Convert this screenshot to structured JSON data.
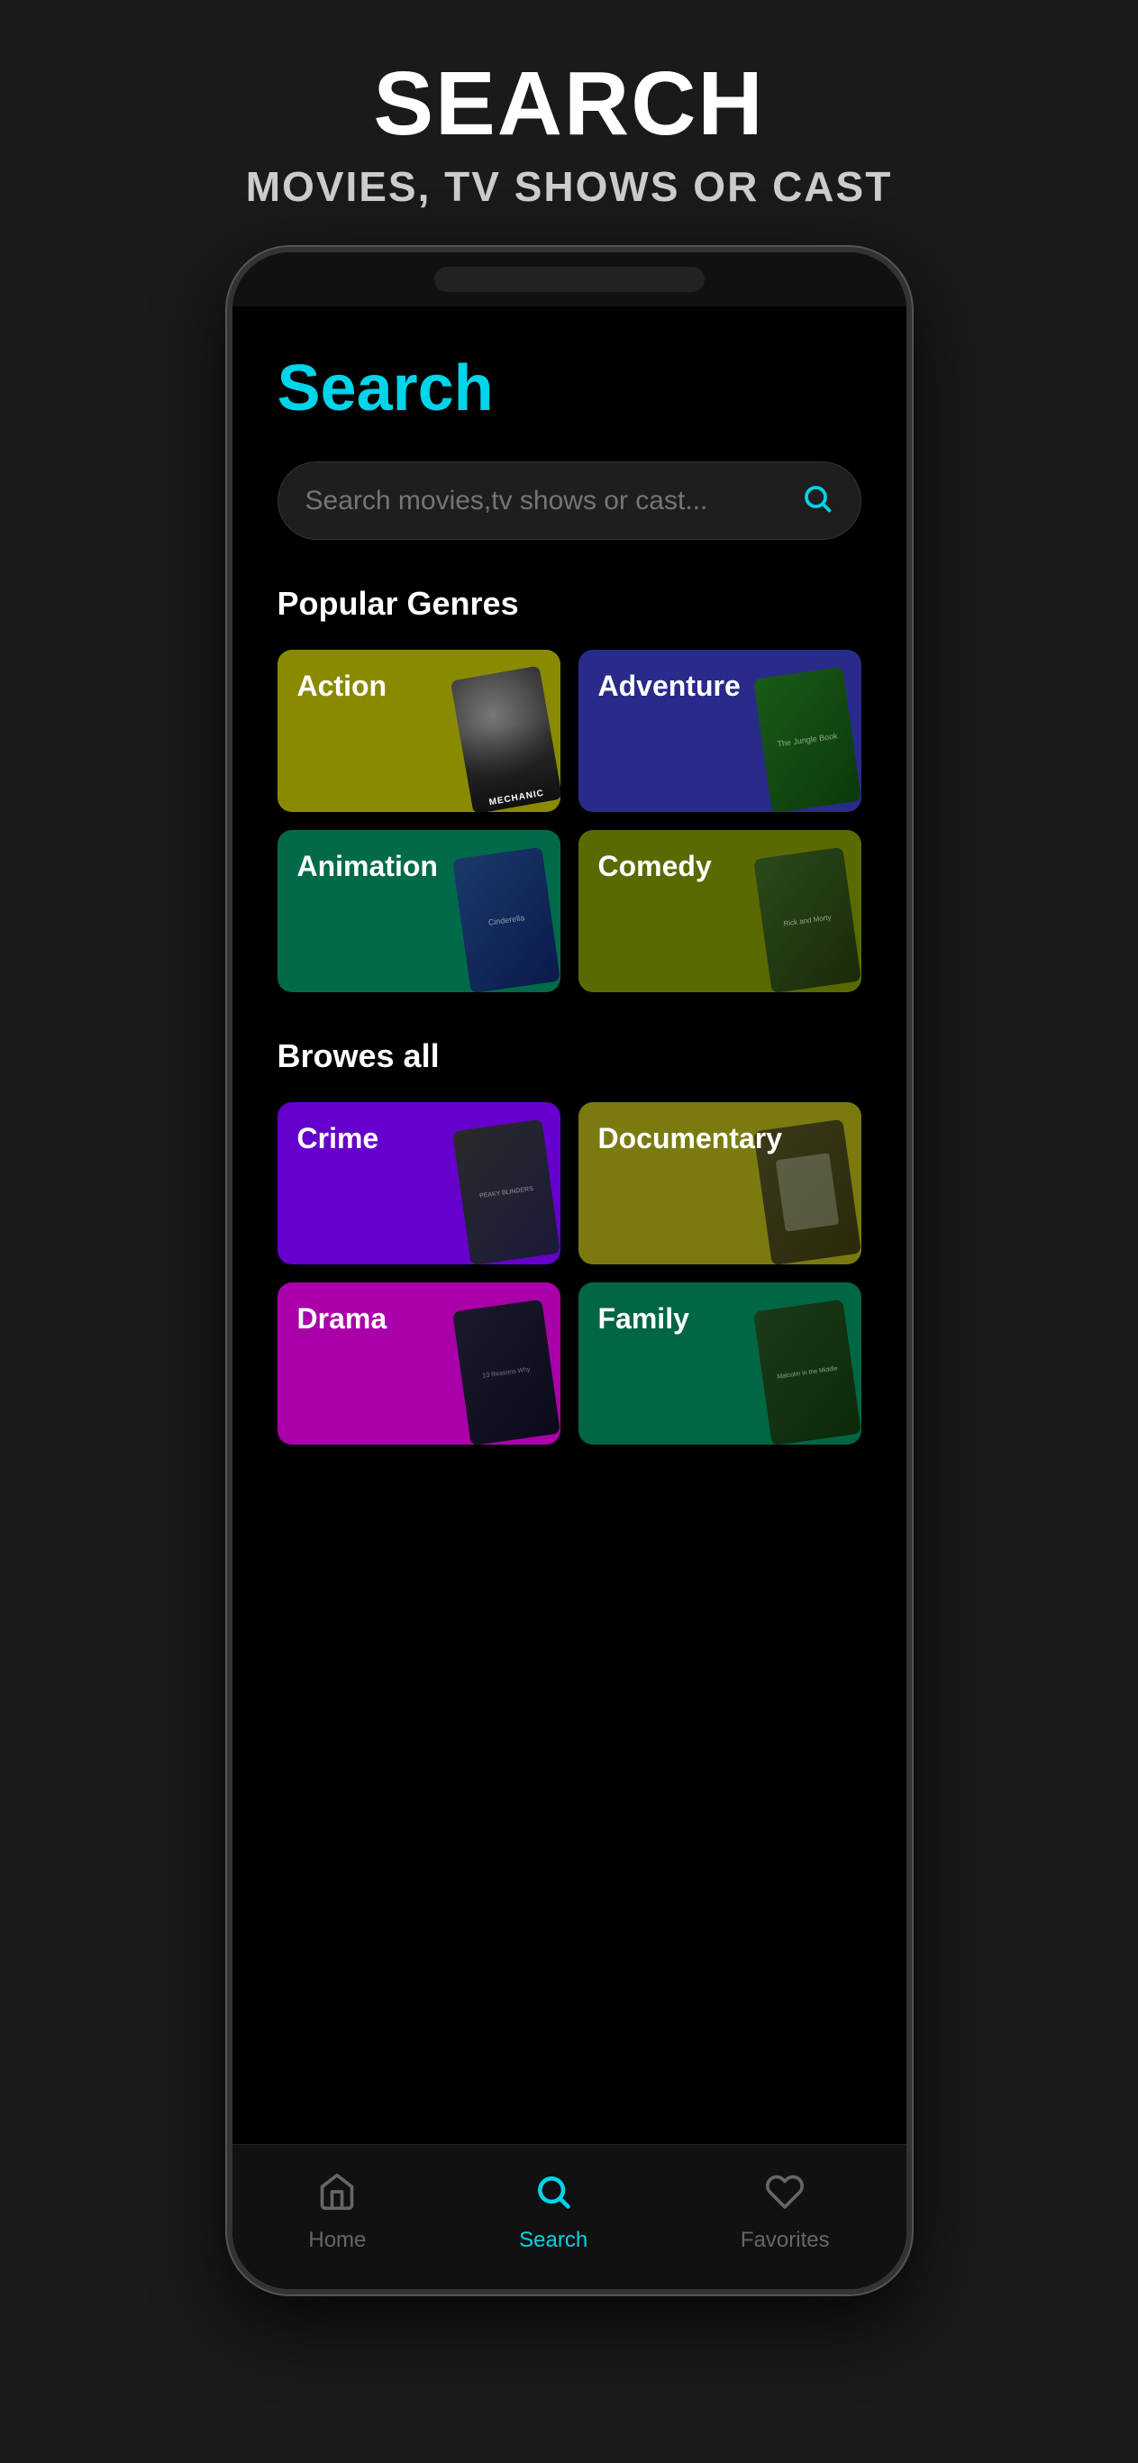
{
  "header": {
    "title": "SEARCH",
    "subtitle": "MOVIES, TV SHOWS OR CAST"
  },
  "app": {
    "page_title": "Search",
    "search_placeholder": "Search movies,tv shows or cast...",
    "popular_genres_label": "Popular Genres",
    "browse_all_label": "Browes all",
    "genres_popular": [
      {
        "id": "action",
        "label": "Action",
        "color_class": "genre-action"
      },
      {
        "id": "adventure",
        "label": "Adventure",
        "color_class": "genre-adventure"
      },
      {
        "id": "animation",
        "label": "Animation",
        "color_class": "genre-animation"
      },
      {
        "id": "comedy",
        "label": "Comedy",
        "color_class": "genre-comedy"
      }
    ],
    "genres_browse": [
      {
        "id": "crime",
        "label": "Crime",
        "color_class": "genre-crime"
      },
      {
        "id": "documentary",
        "label": "Documentary",
        "color_class": "genre-documentary"
      },
      {
        "id": "drama",
        "label": "Drama",
        "color_class": "genre-drama"
      },
      {
        "id": "family",
        "label": "Family",
        "color_class": "genre-family"
      }
    ]
  },
  "bottom_nav": {
    "items": [
      {
        "id": "home",
        "label": "Home",
        "active": false
      },
      {
        "id": "search",
        "label": "Search",
        "active": true
      },
      {
        "id": "favorites",
        "label": "Favorites",
        "active": false
      }
    ]
  },
  "colors": {
    "accent": "#00d4e8",
    "background": "#000000",
    "surface": "#1e1e1e"
  }
}
